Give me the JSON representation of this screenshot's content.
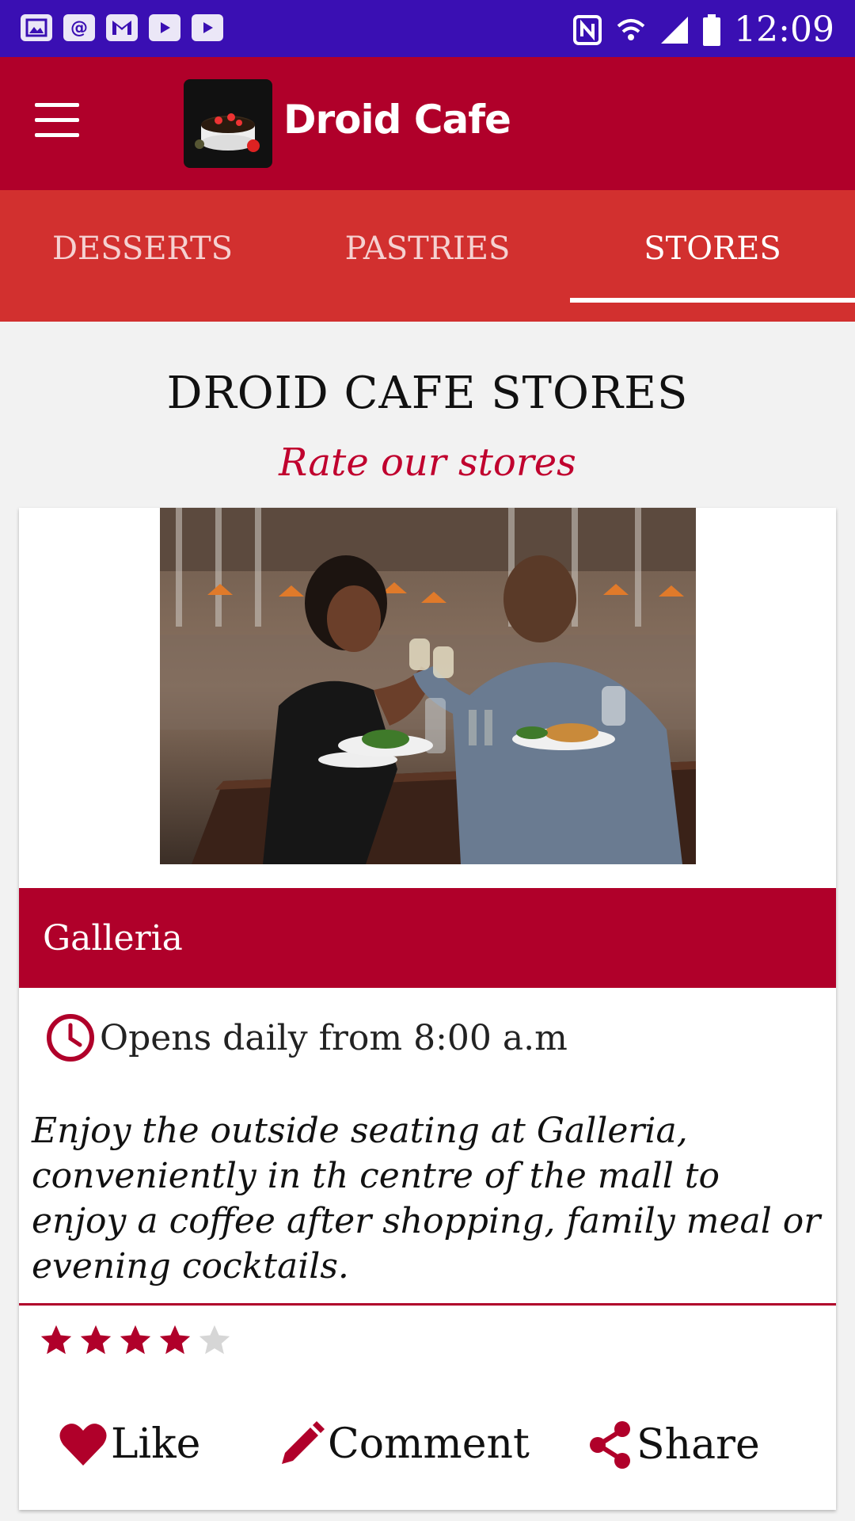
{
  "status_bar": {
    "time": "12:09",
    "left_icons": [
      "image-icon",
      "at-icon",
      "gmail-icon",
      "youtube-icon",
      "youtube-icon"
    ],
    "right_icons": [
      "nfc-icon",
      "wifi-icon",
      "signal-icon",
      "battery-icon"
    ]
  },
  "app_bar": {
    "title": "Droid Cafe",
    "menu_icon": "menu-icon"
  },
  "tabs": [
    {
      "label": "DESSERTS",
      "active": false
    },
    {
      "label": "PASTRIES",
      "active": false
    },
    {
      "label": "STORES",
      "active": true
    }
  ],
  "page": {
    "title": "DROID CAFE STORES",
    "subtitle": "Rate our stores"
  },
  "store": {
    "name": "Galleria",
    "hours": "Opens daily from 8:00 a.m",
    "description": "Enjoy the outside seating at Galleria, conveniently in th centre of the mall to enjoy a coffee after shopping, family meal or evening cocktails.",
    "rating": 4,
    "rating_max": 5
  },
  "actions": {
    "like": "Like",
    "comment": "Comment",
    "share": "Share"
  },
  "colors": {
    "status_bar": "#3a0fb3",
    "primary": "#b0002a",
    "tab_bar": "#d2302f",
    "accent_text": "#c0002e"
  }
}
